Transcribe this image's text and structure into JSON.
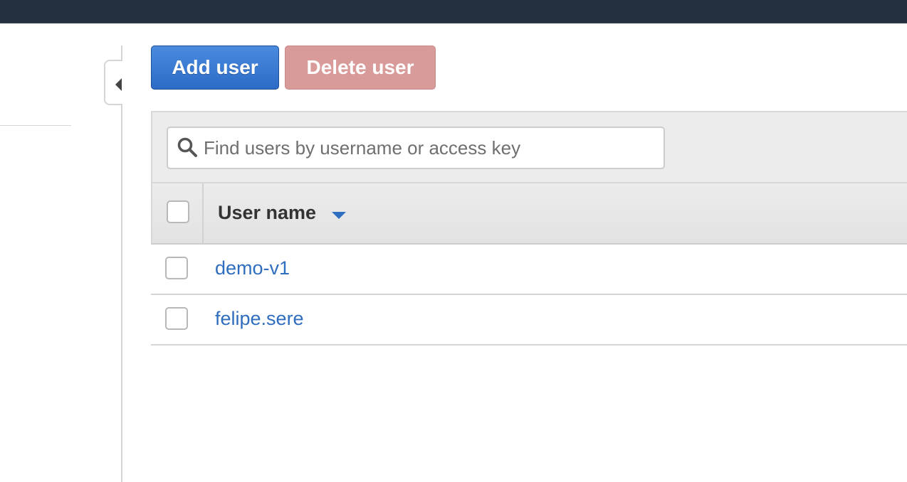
{
  "toolbar": {
    "add_user_label": "Add user",
    "delete_user_label": "Delete user"
  },
  "search": {
    "placeholder": "Find users by username or access key",
    "value": ""
  },
  "table": {
    "columns": [
      "User name"
    ],
    "sort": "descending",
    "rows": [
      {
        "user_name": "demo-v1",
        "selected": false
      },
      {
        "user_name": "felipe.sere",
        "selected": false
      }
    ]
  },
  "icons": {
    "search": "search-icon",
    "sort": "sort-desc-icon",
    "collapse": "chevron-left-icon"
  },
  "colors": {
    "top_bar": "#232f3e",
    "primary_button": "#2c6bc6",
    "delete_button_disabled": "#d99a9a",
    "link": "#2f6dbf"
  }
}
